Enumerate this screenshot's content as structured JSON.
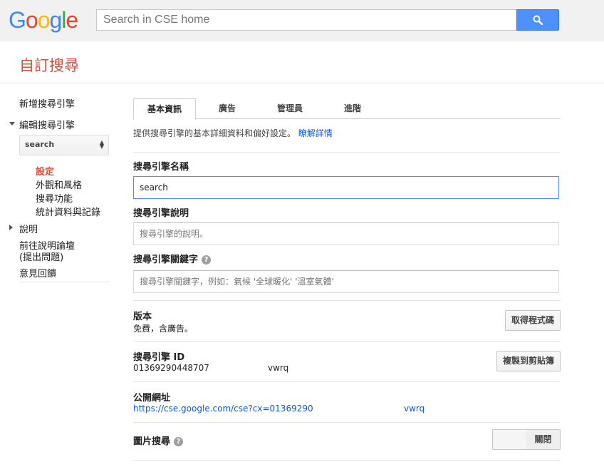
{
  "header": {
    "logo": "Google",
    "search_placeholder": "Search in CSE home"
  },
  "app_title": "自訂搜尋",
  "sidebar": {
    "new_engine": "新增搜尋引擎",
    "edit_engine": "編輯搜尋引擎",
    "selected_engine": "search",
    "sub_items": [
      "設定",
      "外觀和風格",
      "搜尋功能",
      "統計資料與記錄"
    ],
    "help": "說明",
    "forum_line1": "前往說明論壇",
    "forum_line2": "(提出問題)",
    "feedback": "意見回饋"
  },
  "tabs": [
    "基本資訊",
    "廣告",
    "管理員",
    "進階"
  ],
  "intro": {
    "text": "提供搜尋引擎的基本詳細資料和偏好設定。",
    "link": "瞭解詳情"
  },
  "form": {
    "name_label": "搜尋引擎名稱",
    "name_value": "search",
    "desc_label": "搜尋引擎說明",
    "desc_placeholder": "搜尋引擎的說明。",
    "keywords_label": "搜尋引擎關鍵字",
    "keywords_placeholder": "搜尋引擎關鍵字，例如：氣候 '全球暖化' '溫室氣體'"
  },
  "edition": {
    "label": "版本",
    "value": "免費，含廣告。",
    "button": "取得程式碼"
  },
  "engine_id": {
    "label": "搜尋引擎 ID",
    "value_start": "01369290448707",
    "value_end": "vwrq",
    "button": "複製到剪貼簿"
  },
  "public_url": {
    "label": "公開網址",
    "value_start": "https://cse.google.com/cse?cx=01369290",
    "value_end": "vwrq"
  },
  "image_search": {
    "label": "圖片搜尋",
    "state": "關閉"
  },
  "colors": {
    "accent_red": "#dd4b39",
    "link_blue": "#1155cc",
    "search_blue": "#4d90fe"
  }
}
